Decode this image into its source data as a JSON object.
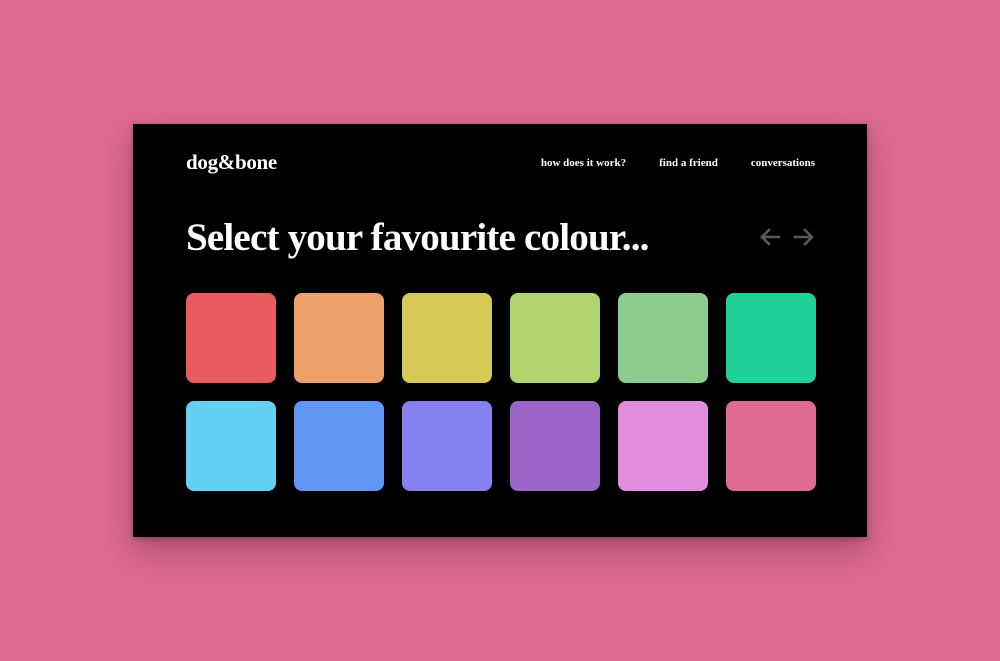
{
  "brand": {
    "logo_text": "dog&bone"
  },
  "nav": {
    "items": [
      "how does it work?",
      "find a friend",
      "conversations"
    ]
  },
  "main": {
    "headline": "Select your favourite colour..."
  },
  "pager": {
    "prev_icon": "arrow-left-icon",
    "next_icon": "arrow-right-icon",
    "arrow_color": "#5a5a5a"
  },
  "colors": {
    "page_background": "#dd6b93",
    "screen_background": "#000000",
    "swatches": [
      "#e85c5e",
      "#eca26a",
      "#d4ca55",
      "#b0d46f",
      "#8ccd8f",
      "#20d19a",
      "#62d1f5",
      "#6196f7",
      "#8780f1",
      "#9d65c8",
      "#e38bdc",
      "#dd6b93"
    ]
  }
}
